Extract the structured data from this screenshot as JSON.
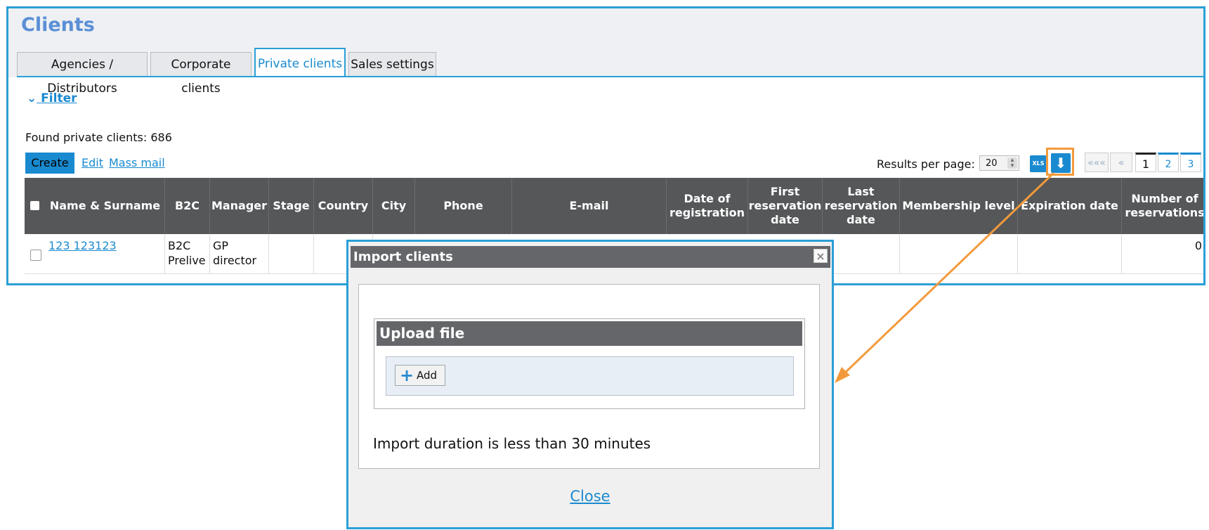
{
  "page": {
    "title": "Clients",
    "tabs": [
      {
        "label": "Agencies / Distributors"
      },
      {
        "label": "Corporate clients"
      },
      {
        "label": "Private clients"
      },
      {
        "label": "Sales settings"
      }
    ],
    "filter_label": "Filter",
    "found_text": "Found private clients: 686",
    "actions": {
      "create": "Create",
      "edit": "Edit",
      "mass_mail": "Mass mail"
    },
    "results_per_page": {
      "label": "Results per page:",
      "value": "20"
    },
    "export_xls_label": "XLS",
    "pagination": {
      "first": "«««",
      "prev": "«",
      "current": "1",
      "pages": [
        "2",
        "3"
      ]
    }
  },
  "table": {
    "columns": [
      {
        "label": "Name & Surname"
      },
      {
        "label": "B2C"
      },
      {
        "label": "Manager"
      },
      {
        "label": "Stage"
      },
      {
        "label": "Country"
      },
      {
        "label": "City"
      },
      {
        "label": "Phone"
      },
      {
        "label": "E-mail"
      },
      {
        "label": "Date of registration"
      },
      {
        "label": "First reservation date"
      },
      {
        "label": "Last reservation date"
      },
      {
        "label": "Membership level"
      },
      {
        "label": "Expiration date"
      },
      {
        "label": "Number of reservations"
      }
    ],
    "rows": [
      {
        "name": "123 123123",
        "b2c": "B2C Prelive",
        "manager": "GP director",
        "reservations": "0"
      }
    ]
  },
  "dialog": {
    "title": "Import clients",
    "close_x": "×",
    "upload_title": "Upload file",
    "add_label": "Add",
    "duration_text": "Import duration is less than 30 minutes",
    "close_label": "Close"
  },
  "colors": {
    "accent": "#1a8ad0",
    "frame": "#2a9fd6",
    "highlight": "#f39a3c",
    "header": "#555759"
  }
}
